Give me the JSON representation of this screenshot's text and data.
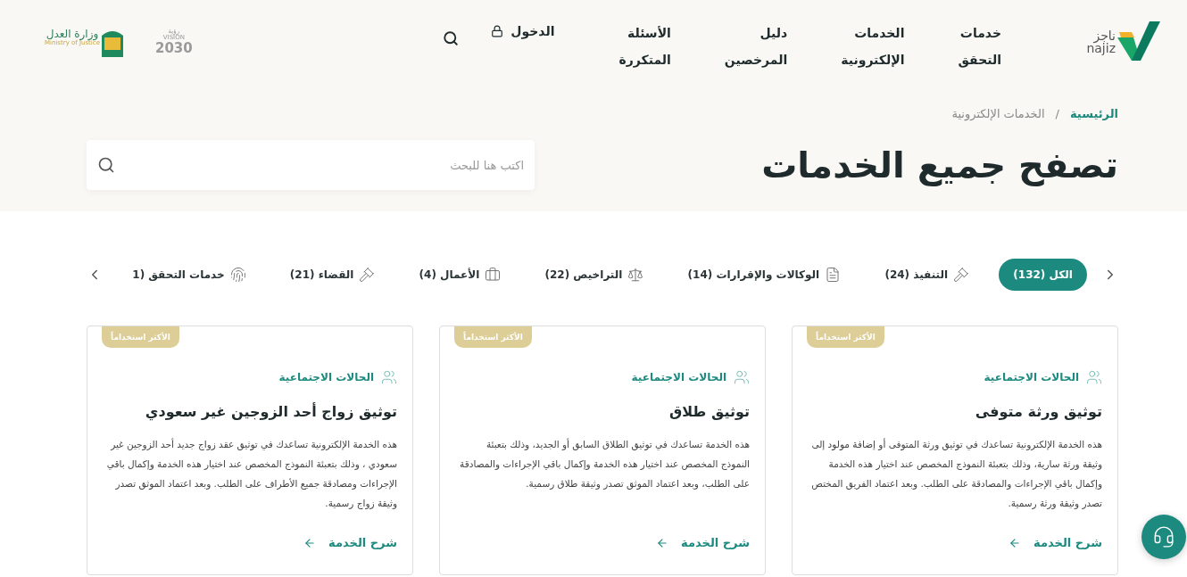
{
  "header": {
    "logo": {
      "arabic": "ناجز",
      "latin": "najiz"
    },
    "nav": [
      {
        "label": "خدمات التحقق"
      },
      {
        "label": "الخدمات الإلكترونية"
      },
      {
        "label": "دليل المرخصين"
      },
      {
        "label": "الأسئلة المتكررة"
      }
    ],
    "login": "الدخول",
    "vision_logo": {
      "latin": "VISION",
      "arabic": "رؤية",
      "year": "2030"
    },
    "ministry_logo": {
      "arabic": "وزارة العدل",
      "latin": "Ministry of Justice"
    }
  },
  "breadcrumb": [
    {
      "label": "الرئيسية",
      "current": false
    },
    {
      "label": "الخدمات الإلكترونية",
      "current": true
    }
  ],
  "breadcrumb_separator": "/",
  "page_title": "تصفح جميع الخدمات",
  "search": {
    "placeholder": "اكتب هنا للبحث"
  },
  "tabs": [
    {
      "label": "الكل (132)",
      "selected": true
    },
    {
      "label": "التنفيذ (24)",
      "selected": false
    },
    {
      "label": "الوكالات والإقرارات (14)",
      "selected": false
    },
    {
      "label": "التراخيص (22)",
      "selected": false
    },
    {
      "label": "الأعمال (4)",
      "selected": false
    },
    {
      "label": "القضاء (21)",
      "selected": false
    },
    {
      "label": "خدمات التحقق (1",
      "selected": false
    }
  ],
  "cards": [
    {
      "badge": "الأكثر استخداماً",
      "category": "الحالات الاجتماعية",
      "title": "توثيق ورثة متوفى",
      "description": "هذه الخدمة الإلكترونية تساعدك في توثيق ورثة المتوفى أو إضافة مولود إلى وثيقة ورثة سارية، وذلك بتعبئة النموذج المخصص عند اختيار هذه الخدمة وإكمال باقي الإجراءات والمصادقة على الطلب. وبعد اعتماد الفريق المختص تصدر وثيقة ورثة رسمية.",
      "link": "شرح الخدمة"
    },
    {
      "badge": "الأكثر استخداماً",
      "category": "الحالات الاجتماعية",
      "title": "توثيق طلاق",
      "description": "هذه الخدمة تساعدك في توثيق الطلاق السابق أو الجديد، وذلك بتعبئة النموذج المخصص عند اختيار هذه الخدمة وإكمال باقي الإجراءات والمصادقة على الطلب، وبعد اعتماد الموثق تصدر وثيقة طلاق رسمية.",
      "link": "شرح الخدمة"
    },
    {
      "badge": "الأكثر استخداماً",
      "category": "الحالات الاجتماعية",
      "title": "توثيق زواج أحد الزوجين غير سعودي",
      "description": "هذه الخدمة الإلكترونية تساعدك في توثيق عقد زواج جديد أحد الزوجين غير سعودي ، وذلك بتعبئة النموذج المخصص عند اختيار هذه الخدمة وإكمال باقي الإجراءات ومصادقة جميع الأطراف على الطلب. وبعد اعتماد الموثق تصدر وثيقة زواج رسمية.",
      "link": "شرح الخدمة"
    }
  ]
}
